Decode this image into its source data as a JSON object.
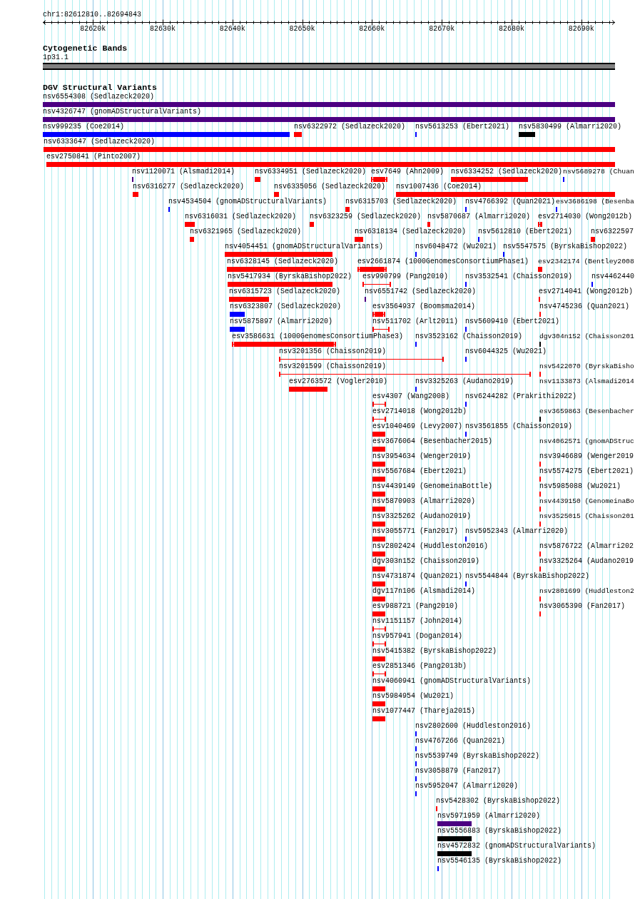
{
  "ruler": {
    "title": "chr1:82612810..82694843",
    "ticks": [
      {
        "label": "82620k"
      },
      {
        "label": "82630k"
      },
      {
        "label": "82640k"
      },
      {
        "label": "82650k"
      },
      {
        "label": "82660k"
      },
      {
        "label": "82670k"
      },
      {
        "label": "82680k"
      },
      {
        "label": "82690k"
      }
    ]
  },
  "tracks": [
    {
      "title": "Cytogenetic Bands",
      "kind": "bands",
      "bands": [
        {
          "label": "1p31.1",
          "color": "#808080"
        }
      ]
    },
    {
      "title": "DGV Structural Variants",
      "kind": "features",
      "rows": [
        {
          "features": [
            {
              "label": "nsv6554308 (Sedlazeck2020)",
              "kind": "box",
              "color": "#4b0082"
            }
          ]
        },
        {
          "features": [
            {
              "label": "nsv4326747 (gnomADStructuralVariants)",
              "kind": "box",
              "color": "#4b0082"
            }
          ]
        },
        {
          "features": [
            {
              "label": "nsv999235 (Coe2014)",
              "kind": "box",
              "color": "#0000ff"
            },
            {
              "label": "nsv6322972 (Sedlazeck2020)",
              "kind": "box",
              "color": "#ff0000"
            },
            {
              "label": "nsv5613253 (Ebert2021)",
              "kind": "box",
              "color": "#0000ff"
            },
            {
              "label": "nsv5830499 (Almarri2020)",
              "kind": "box",
              "color": "#000000"
            }
          ]
        },
        {
          "features": [
            {
              "label": "nsv6333647 (Sedlazeck2020)",
              "kind": "box",
              "color": "#ff0000"
            }
          ]
        },
        {
          "features": [
            {
              "label": "esv2750841 (Pinto2007)",
              "kind": "box",
              "color": "#ff0000"
            }
          ]
        },
        {
          "features": [
            {
              "label": "nsv1120071 (Alsmadi2014)",
              "kind": "box",
              "color": "#4b0082"
            },
            {
              "label": "nsv6334951 (Sedlazeck2020)",
              "kind": "box",
              "color": "#ff0000"
            },
            {
              "label": "esv7649 (Ahn2009)",
              "kind": "capped",
              "color": "#ff0000"
            },
            {
              "label": "nsv6334252 (Sedlazeck2020)",
              "kind": "box",
              "color": "#ff0000"
            },
            {
              "label": "nsv5689278 (Chuan",
              "kind": "box",
              "color": "#0000ff"
            }
          ]
        },
        {
          "features": [
            {
              "label": "nsv6316277 (Sedlazeck2020)",
              "kind": "box",
              "color": "#ff0000"
            },
            {
              "label": "nsv6335056 (Sedlazeck2020)",
              "kind": "box",
              "color": "#ff0000"
            },
            {
              "label": "nsv1007436 (Coe2014)",
              "kind": "box",
              "color": "#ff0000"
            }
          ]
        },
        {
          "features": [
            {
              "label": "nsv4534504 (gnomADStructuralVariants)",
              "kind": "box",
              "color": "#0000ff"
            },
            {
              "label": "nsv6315703 (Sedlazeck2020)",
              "kind": "box",
              "color": "#ff0000"
            },
            {
              "label": "nsv4766392 (Quan2021)",
              "kind": "box",
              "color": "#0000ff"
            },
            {
              "label": "esv3686198 (Besenba",
              "kind": "box",
              "color": "#0000ff"
            }
          ]
        },
        {
          "features": [
            {
              "label": "nsv6316031 (Sedlazeck2020)",
              "kind": "box",
              "color": "#ff0000"
            },
            {
              "label": "nsv6323259 (Sedlazeck2020)",
              "kind": "box",
              "color": "#ff0000"
            },
            {
              "label": "nsv5870687 (Almarri2020)",
              "kind": "box",
              "color": "#ff0000"
            },
            {
              "label": "esv2714030 (Wong2012b)",
              "kind": "capped",
              "color": "#ff0000"
            }
          ]
        },
        {
          "features": [
            {
              "label": "nsv6321965 (Sedlazeck2020)",
              "kind": "box",
              "color": "#ff0000"
            },
            {
              "label": "nsv6318134 (Sedlazeck2020)",
              "kind": "box",
              "color": "#ff0000"
            },
            {
              "label": "nsv5612810 (Ebert2021)",
              "kind": "box",
              "color": "#0000ff"
            },
            {
              "label": "nsv6322597",
              "kind": "box",
              "color": "#ff0000"
            }
          ]
        },
        {
          "features": [
            {
              "label": "nsv4054451 (gnomADStructuralVariants)",
              "kind": "box",
              "color": "#ff0000"
            },
            {
              "label": "nsv6048472 (Wu2021)",
              "kind": "box",
              "color": "#0000ff"
            },
            {
              "label": "nsv5547575 (ByrskaBishop2022)",
              "kind": "box",
              "color": "#0000ff"
            }
          ]
        },
        {
          "features": [
            {
              "label": "nsv6328145 (Sedlazeck2020)",
              "kind": "box",
              "color": "#ff0000"
            },
            {
              "label": "esv2661874 (1000GenomesConsortiumPhase1)",
              "kind": "capped",
              "color": "#ff0000"
            },
            {
              "label": "esv2342174 (Bentley2008",
              "kind": "box",
              "color": "#ff0000"
            }
          ]
        },
        {
          "features": [
            {
              "label": "nsv5417934 (ByrskaBishop2022)",
              "kind": "box",
              "color": "#ff0000"
            },
            {
              "label": "esv990799 (Pang2010)",
              "kind": "whisker",
              "color": "#ff0000"
            },
            {
              "label": "nsv3532541 (Chaisson2019)",
              "kind": "box",
              "color": "#0000ff"
            },
            {
              "label": "nsv4462440",
              "kind": "box",
              "color": "#0000ff"
            }
          ]
        },
        {
          "features": [
            {
              "label": "nsv6315723 (Sedlazeck2020)",
              "kind": "box",
              "color": "#ff0000"
            },
            {
              "label": "nsv6551742 (Sedlazeck2020)",
              "kind": "box",
              "color": "#4b0082"
            },
            {
              "label": "esv2714041 (Wong2012b)",
              "kind": "box",
              "color": "#ff0000"
            }
          ]
        },
        {
          "features": [
            {
              "label": "nsv6323807 (Sedlazeck2020)",
              "kind": "box",
              "color": "#0000ff"
            },
            {
              "label": "esv3564937 (Boomsma2014)",
              "kind": "capped",
              "color": "#ff0000"
            },
            {
              "label": "nsv4745236 (Quan2021)",
              "kind": "box",
              "color": "#ff0000"
            }
          ]
        },
        {
          "features": [
            {
              "label": "nsv5875897 (Almarri2020)",
              "kind": "box",
              "color": "#0000ff"
            },
            {
              "label": "nsv511702 (Arlt2011)",
              "kind": "whisker",
              "color": "#ff0000"
            },
            {
              "label": "nsv5609410 (Ebert2021)",
              "kind": "box",
              "color": "#0000ff"
            }
          ]
        },
        {
          "features": [
            {
              "label": "esv3586631 (1000GenomesConsortiumPhase3)",
              "kind": "capped",
              "color": "#ff0000"
            },
            {
              "label": "nsv3523162 (Chaisson2019)",
              "kind": "box",
              "color": "#0000ff"
            },
            {
              "label": "dgv304n152 (Chaisson201",
              "kind": "box",
              "color": "#000000"
            }
          ]
        },
        {
          "features": [
            {
              "label": "nsv3201356 (Chaisson2019)",
              "kind": "whisker",
              "color": "#ff0000"
            },
            {
              "label": "nsv6044325 (Wu2021)",
              "kind": "box",
              "color": "#0000ff"
            }
          ]
        },
        {
          "features": [
            {
              "label": "nsv3201599 (Chaisson2019)",
              "kind": "whisker",
              "color": "#ff0000"
            },
            {
              "label": "nsv5422070 (ByrskaBisho",
              "kind": "box",
              "color": "#ff0000"
            }
          ]
        },
        {
          "features": [
            {
              "label": "esv2763572 (Vogler2010)",
              "kind": "box",
              "color": "#ff0000"
            },
            {
              "label": "nsv3325263 (Audano2019)",
              "kind": "box",
              "color": "#0000ff"
            },
            {
              "label": "nsv1133873 (Alsmadi2014",
              "kind": "label"
            }
          ]
        },
        {
          "features": [
            {
              "label": "esv4307 (Wang2008)",
              "kind": "whisker",
              "color": "#ff0000"
            },
            {
              "label": "nsv6244282 (Prakrithi2022)",
              "kind": "box",
              "color": "#0000ff"
            }
          ]
        },
        {
          "features": [
            {
              "label": "esv2714018 (Wong2012b)",
              "kind": "whisker",
              "color": "#ff0000"
            },
            {
              "label": "esv3659863 (Besenbacher",
              "kind": "box",
              "color": "#000000"
            }
          ]
        },
        {
          "features": [
            {
              "label": "esv1040469 (Levy2007)",
              "kind": "box",
              "color": "#ff0000"
            },
            {
              "label": "nsv3561855 (Chaisson2019)",
              "kind": "box",
              "color": "#0000ff"
            }
          ]
        },
        {
          "features": [
            {
              "label": "esv3676064 (Besenbacher2015)",
              "kind": "box",
              "color": "#ff0000"
            },
            {
              "label": "nsv4062571 (gnomADStruc",
              "kind": "label"
            }
          ]
        },
        {
          "features": [
            {
              "label": "nsv3954634 (Wenger2019)",
              "kind": "box",
              "color": "#ff0000"
            },
            {
              "label": "nsv3946689 (Wenger2019",
              "kind": "box",
              "color": "#ff0000"
            }
          ]
        },
        {
          "features": [
            {
              "label": "nsv5567684 (Ebert2021)",
              "kind": "box",
              "color": "#ff0000"
            },
            {
              "label": "nsv5574275 (Ebert2021)",
              "kind": "box",
              "color": "#ff0000"
            }
          ]
        },
        {
          "features": [
            {
              "label": "nsv4439149 (GenomeinaBottle)",
              "kind": "box",
              "color": "#ff0000"
            },
            {
              "label": "nsv5985088 (Wu2021)",
              "kind": "box",
              "color": "#ff0000"
            }
          ]
        },
        {
          "features": [
            {
              "label": "nsv5870903 (Almarri2020)",
              "kind": "box",
              "color": "#ff0000"
            },
            {
              "label": "nsv4439150 (GenomeinaBo",
              "kind": "box",
              "color": "#ff0000"
            }
          ]
        },
        {
          "features": [
            {
              "label": "nsv3325262 (Audano2019)",
              "kind": "box",
              "color": "#ff0000"
            },
            {
              "label": "nsv3525015 (Chaisson201",
              "kind": "box",
              "color": "#ff0000"
            }
          ]
        },
        {
          "features": [
            {
              "label": "nsv3055771 (Fan2017)",
              "kind": "box",
              "color": "#ff0000"
            },
            {
              "label": "nsv5952343 (Almarri2020)",
              "kind": "box",
              "color": "#0000ff"
            }
          ]
        },
        {
          "features": [
            {
              "label": "nsv2802424 (Huddleston2016)",
              "kind": "box",
              "color": "#ff0000"
            },
            {
              "label": "nsv5876722 (Almarri202",
              "kind": "box",
              "color": "#ff0000"
            }
          ]
        },
        {
          "features": [
            {
              "label": "dgv303n152 (Chaisson2019)",
              "kind": "box",
              "color": "#ff0000"
            },
            {
              "label": "nsv3325264 (Audano2019",
              "kind": "box",
              "color": "#ff0000"
            }
          ]
        },
        {
          "features": [
            {
              "label": "nsv4731874 (Quan2021)",
              "kind": "box",
              "color": "#ff0000"
            },
            {
              "label": "nsv5544844 (ByrskaBishop2022)",
              "kind": "box",
              "color": "#0000ff"
            }
          ]
        },
        {
          "features": [
            {
              "label": "dgv117n106 (Alsmadi2014)",
              "kind": "box",
              "color": "#ff0000"
            },
            {
              "label": "nsv2801699 (Huddleston2",
              "kind": "box",
              "color": "#ff0000"
            }
          ]
        },
        {
          "features": [
            {
              "label": "esv988721 (Pang2010)",
              "kind": "box",
              "color": "#ff0000"
            },
            {
              "label": "nsv3065390 (Fan2017)",
              "kind": "box",
              "color": "#ff0000"
            }
          ]
        },
        {
          "features": [
            {
              "label": "nsv1151157 (John2014)",
              "kind": "whisker",
              "color": "#ff0000"
            }
          ]
        },
        {
          "features": [
            {
              "label": "nsv957941 (Dogan2014)",
              "kind": "whisker",
              "color": "#ff0000"
            }
          ]
        },
        {
          "features": [
            {
              "label": "nsv5415382 (ByrskaBishop2022)",
              "kind": "box",
              "color": "#ff0000"
            }
          ]
        },
        {
          "features": [
            {
              "label": "esv2851346 (Pang2013b)",
              "kind": "whisker",
              "color": "#ff0000"
            }
          ]
        },
        {
          "features": [
            {
              "label": "nsv4060941 (gnomADStructuralVariants)",
              "kind": "box",
              "color": "#ff0000"
            }
          ]
        },
        {
          "features": [
            {
              "label": "nsv5984954 (Wu2021)",
              "kind": "box",
              "color": "#ff0000"
            }
          ]
        },
        {
          "features": [
            {
              "label": "nsv1077447 (Thareja2015)",
              "kind": "box",
              "color": "#ff0000"
            }
          ]
        },
        {
          "features": [
            {
              "label": "nsv2802600 (Huddleston2016)",
              "kind": "box",
              "color": "#0000ff"
            }
          ]
        },
        {
          "features": [
            {
              "label": "nsv4767266 (Quan2021)",
              "kind": "box",
              "color": "#0000ff"
            }
          ]
        },
        {
          "features": [
            {
              "label": "nsv5539749 (ByrskaBishop2022)",
              "kind": "box",
              "color": "#0000ff"
            }
          ]
        },
        {
          "features": [
            {
              "label": "nsv3058879 (Fan2017)",
              "kind": "box",
              "color": "#0000ff"
            }
          ]
        },
        {
          "features": [
            {
              "label": "nsv5952047 (Almarri2020)",
              "kind": "box",
              "color": "#0000ff"
            }
          ]
        },
        {
          "features": [
            {
              "label": "nsv5428302 (ByrskaBishop2022)",
              "kind": "box",
              "color": "#ff0000"
            }
          ]
        },
        {
          "features": [
            {
              "label": "nsv5971959 (Almarri2020)",
              "kind": "box",
              "color": "#4b0082"
            }
          ]
        },
        {
          "features": [
            {
              "label": "nsv5556883 (ByrskaBishop2022)",
              "kind": "box",
              "color": "#000000"
            }
          ]
        },
        {
          "features": [
            {
              "label": "nsv4572832 (gnomADStructuralVariants)",
              "kind": "box",
              "color": "#000000"
            }
          ]
        },
        {
          "features": [
            {
              "label": "nsv5546135 (ByrskaBishop2022)",
              "kind": "box",
              "color": "#0000ff"
            }
          ]
        }
      ]
    }
  ]
}
